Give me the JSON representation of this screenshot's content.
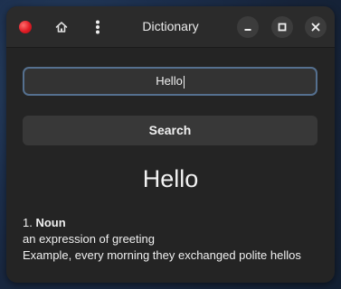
{
  "window": {
    "title": "Dictionary"
  },
  "headerbar": {
    "app_icon": "red-circle-app-icon",
    "home_icon": "home-icon",
    "menu_icon": "vertical-dots-menu-icon",
    "minimize_icon": "minimize-icon",
    "maximize_icon": "maximize-icon",
    "close_icon": "close-icon"
  },
  "search": {
    "value": "Hello",
    "button_label": "Search"
  },
  "result": {
    "word": "Hello",
    "definitions": [
      {
        "index": "1.",
        "part_of_speech": "Noun",
        "meaning": "an expression of greeting",
        "example": "Example, every morning they exchanged polite hellos"
      }
    ]
  },
  "colors": {
    "accent_focus_border": "#55708f",
    "app_icon_red": "#e01b24",
    "window_bg": "#242424",
    "headerbar_bg": "#2b2b2b"
  }
}
